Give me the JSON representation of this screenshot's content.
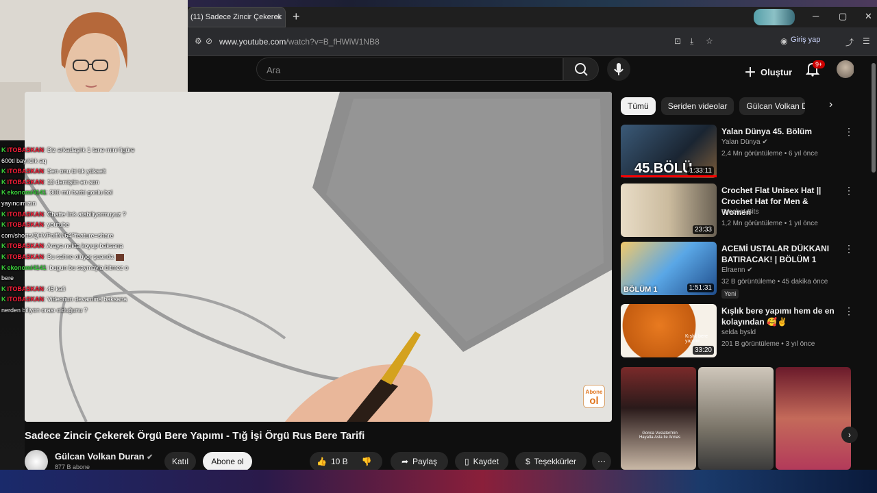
{
  "browser": {
    "tab_title": "(11) Sadece Zincir Çekerek",
    "tab_close": "×",
    "new_tab": "+",
    "url_domain": "www.youtube.com",
    "url_path": "/watch?v=B_fHWiW1NB8",
    "sign_in": "Giriş yap",
    "minimize": "─",
    "maximize": "▢",
    "close": "✕"
  },
  "masthead": {
    "search_placeholder": "Ara",
    "create_label": "Oluştur",
    "notification_count": "9+"
  },
  "video": {
    "title": "Sadece Zincir Çekerek Örgü Bere Yapımı - Tığ İşi Örgü Rus Bere Tarifi",
    "watermark_top": "Abone",
    "watermark_bottom": "ol"
  },
  "channel": {
    "name": "Gülcan Volkan Duran",
    "subscribers": "877 B abone",
    "join_label": "Katıl",
    "subscribe_label": "Abone ol"
  },
  "actions": {
    "likes": "10 B",
    "share": "Paylaş",
    "save": "Kaydet",
    "thanks": "Teşekkürler",
    "more": "⋯"
  },
  "chips": [
    "Tümü",
    "Seriden videolar",
    "Gülcan Volkan Duran"
  ],
  "recommendations": [
    {
      "title": "Yalan Dünya 45. Bölüm",
      "channel": "Yalan Dünya",
      "meta": "2,4 Mn görüntüleme • 6 yıl önce",
      "duration": "1:33:11",
      "thumb_text": "45.BÖLÜ",
      "verified": true
    },
    {
      "title": "Crochet Flat Unisex Hat || Crochet Hat for Men & Women",
      "channel": "Crochet Bits",
      "meta": "1,2 Mn görüntüleme • 1 yıl önce",
      "duration": "23:33",
      "thumb_text": "",
      "verified": false
    },
    {
      "title": "ACEMİ USTALAR DÜKKANI BATIRACAK! | BÖLÜM 1",
      "channel": "Elraenn",
      "meta": "32 B görüntüleme • 45 dakika önce",
      "duration": "1:51:31",
      "thumb_text": "BÖLÜM 1",
      "verified": true,
      "badge": "Yeni"
    },
    {
      "title": "Kışlık bere yapımı hem de en kolayından 🥰✌️",
      "channel": "selda bysld",
      "meta": "201 B görüntüleme • 3 yıl önce",
      "duration": "33:20",
      "thumb_text": "Kışlık bere yapımı",
      "verified": false
    }
  ],
  "shorts_caption": "Gonca Vuslateri'nin Hayatta Asla Ile Annas",
  "chat": [
    {
      "user": "ITOBASKAN",
      "msg": ": Biz arkadaşlık 1 tane mini figüre",
      "color": "red"
    },
    {
      "user": "",
      "msg": "600tl bayıldık aq",
      "color": ""
    },
    {
      "user": "ITOBASKAN",
      "msg": ": Sen onu bi tık yükselt",
      "color": "red"
    },
    {
      "user": "ITOBASKAN",
      "msg": ": 13 demiştin en son",
      "color": "red"
    },
    {
      "user": "ekonomi4141",
      "msg": ": 300 mü harbi gonlu bol",
      "color": "green"
    },
    {
      "user": "",
      "msg": "yayıncımızın",
      "color": ""
    },
    {
      "user": "ITOBASKAN",
      "msg": ": Chatte link atabiliyormuyuz ?",
      "color": "red"
    },
    {
      "user": "ITOBASKAN",
      "msg": ": youtube",
      "color": "red"
    },
    {
      "user": "",
      "msg": "com/shorts/QHVPolfNv64?feature=share",
      "color": ""
    },
    {
      "user": "ITOBASKAN",
      "msg": ": Araya nokta koyup baksana",
      "color": "red"
    },
    {
      "user": "ITOBASKAN",
      "msg": ": Bu sahne oluyor şuanda",
      "color": "red",
      "emote": true
    },
    {
      "user": "ekonomi4141",
      "msg": ": bugun bu saymayla bitmez o",
      "color": "green"
    },
    {
      "user": "",
      "msg": "bere",
      "color": ""
    },
    {
      "user": "ITOBASKAN",
      "msg": ": 45 kafi",
      "color": "red"
    },
    {
      "user": "ITOBASKAN",
      "msg": ": Videonun devamına baksana",
      "color": "red"
    },
    {
      "user": "",
      "msg": "nerden biliyon orası olduğunu ?",
      "color": ""
    }
  ]
}
